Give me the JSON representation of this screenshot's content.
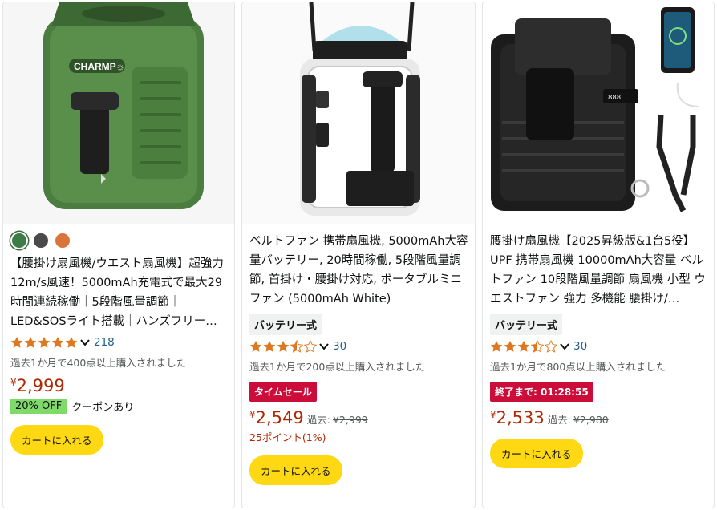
{
  "colors": {
    "accent_price": "#b12704",
    "cart_button": "#ffd814",
    "deal_badge": "#cc0c39",
    "star": "#de7921",
    "link": "#1f5f8b",
    "coupon": "#7fda69"
  },
  "products": [
    {
      "image_icon": "green-waist-fan-image",
      "brand_logo": "CHARMP",
      "swatches": [
        "#3f7b46",
        "#4a4a4a",
        "#d9743a"
      ],
      "title": "【腰掛け扇風機/ウエスト扇風機】超強力12m/s風速！5000mAh充電式で最大29時間連続稼働｜5段階風量調節｜LED&SOSライト搭載｜ハンズフリークリ…",
      "rating": 5,
      "review_count": "218",
      "bought": "過去1か月で400点以上購入されました",
      "price_symbol": "¥",
      "price": "2,999",
      "coupon_badge": "20% OFF",
      "coupon_text": "クーポンあり",
      "cart_label": "カートに入れる"
    },
    {
      "image_icon": "white-belt-fan-image",
      "title": "ベルトファン 携帯扇風機, 5000mAh大容量バッテリー, 20時間稼働, 5段階風量調節, 首掛け・腰掛け対応, ポータブルミニファン (5000mAh White)",
      "type_badge": "バッテリー式",
      "rating": 3.5,
      "review_count": "30",
      "bought": "過去1か月で200点以上購入されました",
      "deal_badge": "タイムセール",
      "price_symbol": "¥",
      "price": "2,549",
      "past_label": "過去:",
      "past_price": "¥2,999",
      "points": "25ポイント(1%)",
      "cart_label": "カートに入れる"
    },
    {
      "image_icon": "black-waist-fan-image",
      "title": "腰掛け扇風機【2025昇級版&1台5役】UPF 携帯扇風機 10000mAh大容量 ベルトファン 10段階風量調節 扇風機 小型 ウエストファン 強力 多機能 腰掛け/…",
      "type_badge": "バッテリー式",
      "rating": 3.5,
      "review_count": "30",
      "bought": "過去1か月で800点以上購入されました",
      "deal_badge": "終了まで: 01:28:55",
      "price_symbol": "¥",
      "price": "2,533",
      "past_label": "過去:",
      "past_price": "¥2,980",
      "cart_label": "カートに入れる"
    }
  ]
}
